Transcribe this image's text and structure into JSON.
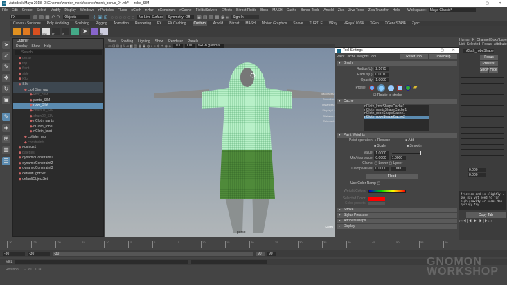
{
  "window": {
    "title": "Autodesk Maya 2018: D:\\Gnomon\\warrior_monk\\scenes\\monk_bonus_04.mb*  ---  robe_SIM",
    "min": "–",
    "max": "▢",
    "close": "✕"
  },
  "menubar": [
    "File",
    "Edit",
    "Create",
    "Select",
    "Modify",
    "Display",
    "Windows",
    "nParticles",
    "Fluids",
    "nCloth",
    "nHair",
    "nConstraint",
    "nCache",
    "Fields/Solvers",
    "Effects",
    "Bifrost Fluids",
    "Boss",
    "MASH",
    "Cache",
    "Bonus Tools",
    "Arnold",
    "Ziva",
    "Ziva Tools",
    "Ziva Transfer",
    "Help"
  ],
  "workspace": {
    "label": "Workspace :",
    "value": "Maya Classic*"
  },
  "status": {
    "mode": "FX",
    "objects": "Objects",
    "live": "No Live Surface",
    "symmetry": "Symmetry: Off",
    "signin": "Sign In"
  },
  "shelf_tabs": [
    "Curves / Surfaces",
    "Poly Modeling",
    "Sculpting",
    "Rigging",
    "Animation",
    "Rendering",
    "FX",
    "FX Caching",
    "Custom",
    "Arnold",
    "Bifrost",
    "MASH",
    "Motion Graphics",
    "Shave",
    "TURTLE",
    "VRay",
    "VRaya10164",
    "XGen",
    "XGenaS7484",
    "Zync"
  ],
  "shelf_active": "Custom",
  "shelf_labels": [
    "nRan",
    "FT",
    "KT",
    "M"
  ],
  "outliner": {
    "title": "Outliner",
    "menu": [
      "Display",
      "Show",
      "Help"
    ],
    "search_placeholder": "Search...",
    "items": [
      {
        "label": "persp",
        "indent": 1,
        "state": "dim"
      },
      {
        "label": "top",
        "indent": 1,
        "state": "dim"
      },
      {
        "label": "front",
        "indent": 1,
        "state": "dim"
      },
      {
        "label": "side",
        "indent": 1,
        "state": "dim"
      },
      {
        "label": "RIG",
        "indent": 1,
        "state": "dim"
      },
      {
        "label": "SIM",
        "indent": 1,
        "state": "hl"
      },
      {
        "label": "clothSim_grp",
        "indent": 2,
        "state": "hl"
      },
      {
        "label": "knot_SIM",
        "indent": 3,
        "state": "dim"
      },
      {
        "label": "pants_SIM",
        "indent": 3,
        "state": ""
      },
      {
        "label": "robe_SIM",
        "indent": 3,
        "state": "sel"
      },
      {
        "label": "chain01_SIM",
        "indent": 3,
        "state": "dim"
      },
      {
        "label": "chain02_SIM",
        "indent": 3,
        "state": "dim"
      },
      {
        "label": "nCloth_pants",
        "indent": 3,
        "state": ""
      },
      {
        "label": "nCloth_robe",
        "indent": 3,
        "state": ""
      },
      {
        "label": "nCloth_knot",
        "indent": 3,
        "state": ""
      },
      {
        "label": "collider_grp",
        "indent": 2,
        "state": ""
      },
      {
        "label": "constraints",
        "indent": 2,
        "state": "dim"
      },
      {
        "label": "nucleus1",
        "indent": 1,
        "state": ""
      },
      {
        "label": "palettes",
        "indent": 1,
        "state": "dim"
      },
      {
        "label": "dynamicConstraint1",
        "indent": 1,
        "state": ""
      },
      {
        "label": "dynamicConstraint2",
        "indent": 1,
        "state": ""
      },
      {
        "label": "dynamicConstraint3",
        "indent": 1,
        "state": ""
      },
      {
        "label": "defaultLightSet",
        "indent": 1,
        "state": ""
      },
      {
        "label": "defaultObjectSet",
        "indent": 1,
        "state": ""
      }
    ]
  },
  "viewport": {
    "menu": [
      "View",
      "Shading",
      "Lighting",
      "Show",
      "Renderer",
      "Panels"
    ],
    "exposure": "0.00",
    "gamma": "1.00",
    "colorspace": "sRGB gamma",
    "hud": [
      "Backfaces:",
      "Smoothn:",
      "Instances:",
      "Display L:",
      "Distance:",
      "Selected:"
    ],
    "camera": "persp",
    "axis_label": "Fram"
  },
  "tool_settings": {
    "title": "Tool Settings",
    "tool_name": "Paint Cache Weights Tool",
    "reset": "Reset Tool",
    "help": "Tool Help",
    "brush": {
      "title": "Brush",
      "radius_u_label": "Radius(U):",
      "radius_u": "2.5675",
      "radius_l_label": "Radius(L):",
      "radius_l": "0.0010",
      "opacity_label": "Opacity:",
      "opacity": "1.0000",
      "profile_label": "Profile:",
      "rotate_label": "Rotate to stroke"
    },
    "cache": {
      "title": "Cache",
      "items": [
        "nCloth_knotShapeCache1",
        "nCloth_pantsShapeCache1",
        "nCloth_robeShapeCache1",
        "nCloth_robeShapeCache2"
      ],
      "selected": 3
    },
    "paint": {
      "title": "Paint Weights",
      "op_label": "Paint operation:",
      "ops": [
        "Replace",
        "Add",
        "Scale",
        "Smooth"
      ],
      "value_label": "Value:",
      "value": "1.0000",
      "value_fraction": 1.0,
      "minmax_label": "Min/Max value:",
      "min": "0.0000",
      "max": "1.0000",
      "clamp_label": "Clamp:",
      "lower": "Lower",
      "upper": "Upper",
      "clampv_label": "Clamp values:",
      "cmin": "0.0000",
      "cmax": "1.0000",
      "flood": "Flood",
      "ramp_label": "Use Color Ramp",
      "weight_colors": "Weight Colors:",
      "selected_color": "Selected Color:",
      "color_presets": "Color presets:"
    },
    "collapsed": [
      "Stroke",
      "Stylus Pressure",
      "Attribute Maps",
      "Display"
    ]
  },
  "attr_editor": {
    "tabs": [
      "Human IK",
      "Channel Box / Layer Editor",
      "Attribute Editor"
    ],
    "menu": [
      "List",
      "Selected",
      "Focus",
      "Attributes",
      "Show",
      "Help"
    ],
    "node": "nCloth_robeShape",
    "focus": "Focus",
    "presets": "Presets*",
    "show": "Show",
    "hide": "Hide",
    "field1": "0.000",
    "field2": "0.000",
    "desc": "friction and is slightly . One may yet need to for high gravity or seems too springy try",
    "copy_tab": "Copy Tab"
  },
  "timeline": {
    "ticks": [
      "-30",
      "-25",
      "-20",
      "-15",
      "-10",
      "-5",
      "0",
      "5",
      "10",
      "15",
      "20",
      "25",
      "30",
      "35",
      "40",
      "45",
      "50",
      "55",
      "60"
    ],
    "current": "-30"
  },
  "range": {
    "start": "-30",
    "min": "-30",
    "slider_start": "-30",
    "slider_end": "90",
    "end": "90"
  },
  "mel": {
    "label": "MEL"
  },
  "help_line": {
    "label": "Rotation:",
    "v1": "-7.20",
    "v2": "0.60"
  },
  "watermark": {
    "line1": "GNOMON",
    "line2": "WORKSHOP"
  }
}
